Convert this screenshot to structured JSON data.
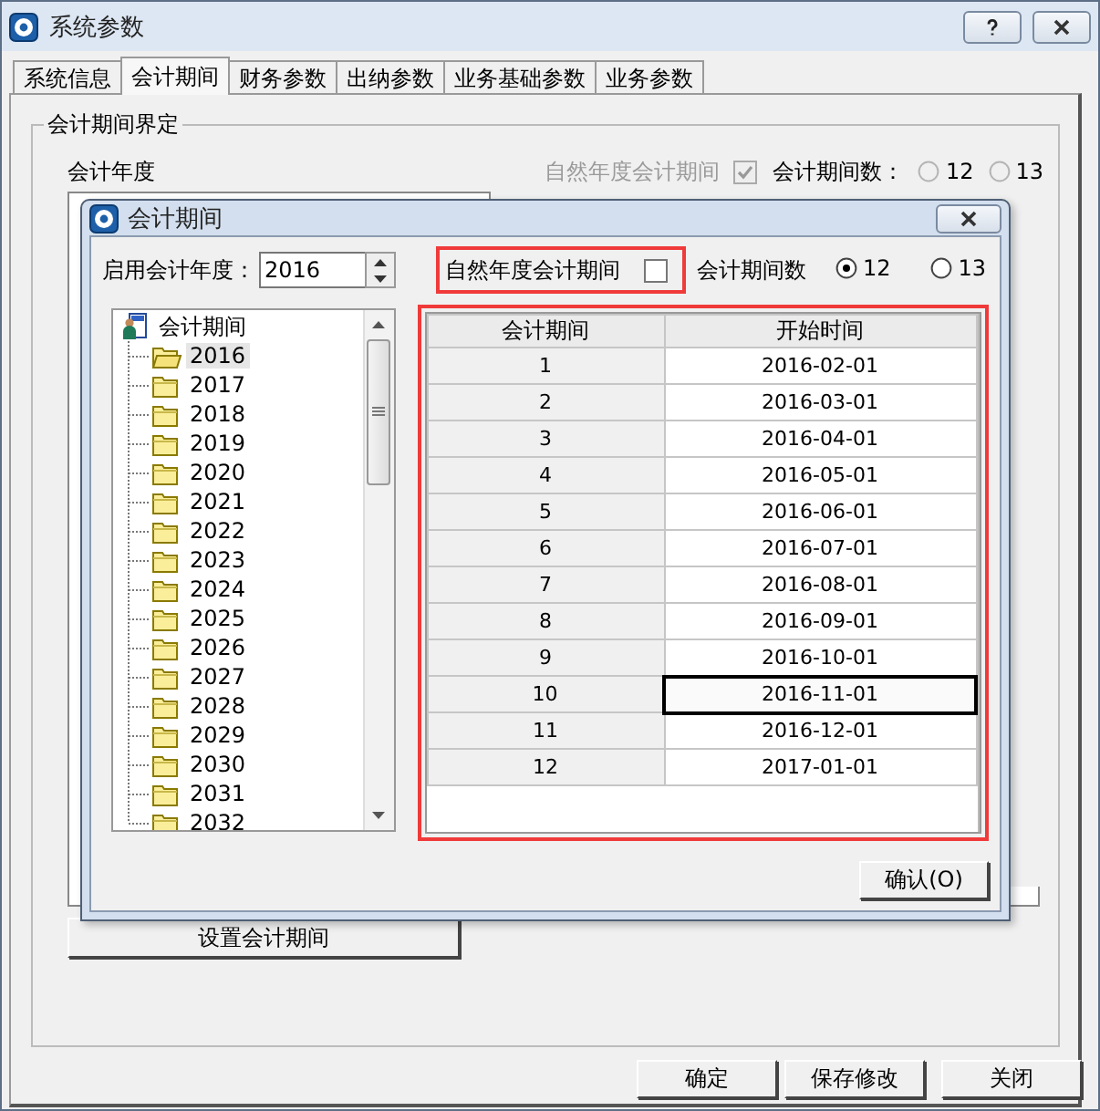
{
  "window": {
    "title": "系统参数"
  },
  "tabs": [
    {
      "label": "系统信息",
      "selected": false
    },
    {
      "label": "会计期间",
      "selected": true
    },
    {
      "label": "财务参数",
      "selected": false
    },
    {
      "label": "出纳参数",
      "selected": false
    },
    {
      "label": "业务基础参数",
      "selected": false
    },
    {
      "label": "业务参数",
      "selected": false
    }
  ],
  "group": {
    "title": "会计期间界定",
    "year_label": "会计年度",
    "natural_year": {
      "label": "自然年度会计期间",
      "checked": true,
      "disabled": true
    },
    "period_count": {
      "label": "会计期间数：",
      "disabled": true,
      "options": [
        {
          "label": "12",
          "selected": false
        },
        {
          "label": "13",
          "selected": false
        }
      ]
    },
    "set_button": "设置会计期间"
  },
  "dialog": {
    "title": "会计期间",
    "start_year": {
      "label": "启用会计年度：",
      "value": "2016"
    },
    "natural_year": {
      "label": "自然年度会计期间",
      "checked": false
    },
    "period_count": {
      "label": "会计期间数",
      "disabled": false,
      "options": [
        {
          "label": "12",
          "selected": true
        },
        {
          "label": "13",
          "selected": false
        }
      ]
    },
    "tree": {
      "label": "会计期间",
      "children": [
        {
          "label": "2016",
          "selected": true
        },
        {
          "label": "2017",
          "selected": false
        },
        {
          "label": "2018",
          "selected": false
        },
        {
          "label": "2019",
          "selected": false
        },
        {
          "label": "2020",
          "selected": false
        },
        {
          "label": "2021",
          "selected": false
        },
        {
          "label": "2022",
          "selected": false
        },
        {
          "label": "2023",
          "selected": false
        },
        {
          "label": "2024",
          "selected": false
        },
        {
          "label": "2025",
          "selected": false
        },
        {
          "label": "2026",
          "selected": false
        },
        {
          "label": "2027",
          "selected": false
        },
        {
          "label": "2028",
          "selected": false
        },
        {
          "label": "2029",
          "selected": false
        },
        {
          "label": "2030",
          "selected": false
        },
        {
          "label": "2031",
          "selected": false
        },
        {
          "label": "2032",
          "selected": false
        }
      ]
    },
    "table": {
      "columns": [
        "会计期间",
        "开始时间"
      ],
      "rows": [
        {
          "period": "1",
          "start": "2016-02-01",
          "selected": false
        },
        {
          "period": "2",
          "start": "2016-03-01",
          "selected": false
        },
        {
          "period": "3",
          "start": "2016-04-01",
          "selected": false
        },
        {
          "period": "4",
          "start": "2016-05-01",
          "selected": false
        },
        {
          "period": "5",
          "start": "2016-06-01",
          "selected": false
        },
        {
          "period": "6",
          "start": "2016-07-01",
          "selected": false
        },
        {
          "period": "7",
          "start": "2016-08-01",
          "selected": false
        },
        {
          "period": "8",
          "start": "2016-09-01",
          "selected": false
        },
        {
          "period": "9",
          "start": "2016-10-01",
          "selected": false
        },
        {
          "period": "10",
          "start": "2016-11-01",
          "selected": true
        },
        {
          "period": "11",
          "start": "2016-12-01",
          "selected": false
        },
        {
          "period": "12",
          "start": "2017-01-01",
          "selected": false
        }
      ]
    },
    "confirm_button": "确认(O)"
  },
  "buttons": [
    "确定",
    "保存修改",
    "关闭"
  ]
}
